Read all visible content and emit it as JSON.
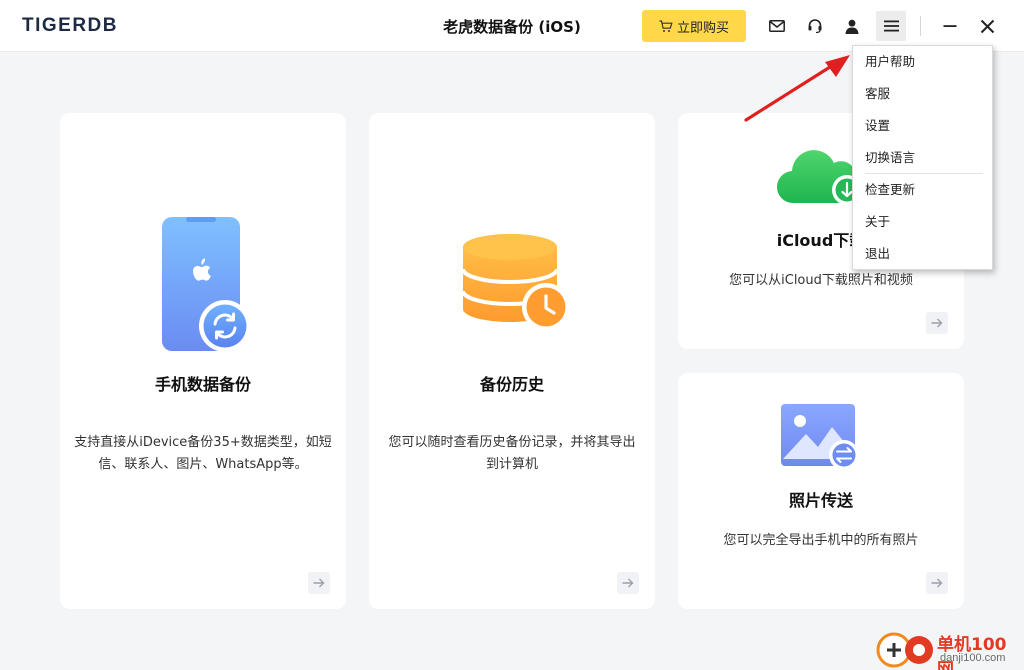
{
  "header": {
    "logo": "TIGERDB",
    "title": "老虎数据备份 (iOS)",
    "buy_label": "立即购买"
  },
  "cards": {
    "backup": {
      "title": "手机数据备份",
      "desc": "支持直接从iDevice备份35+数据类型，如短信、联系人、图片、WhatsApp等。"
    },
    "history": {
      "title": "备份历史",
      "desc": "您可以随时查看历史备份记录，并将其导出到计算机"
    },
    "icloud": {
      "title": "iCloud下载",
      "desc": "您可以从iCloud下载照片和视频"
    },
    "photos": {
      "title": "照片传送",
      "desc": "您可以完全导出手机中的所有照片"
    }
  },
  "menu": {
    "items": [
      "用户帮助",
      "客服",
      "设置",
      "切换语言",
      "检查更新",
      "关于",
      "退出"
    ]
  },
  "watermark": {
    "title": "单机100网",
    "url": "danji100.com"
  },
  "colors": {
    "buy_button": "#ffd84a",
    "annotation_arrow": "#e02020",
    "background": "#f4f5f7"
  }
}
